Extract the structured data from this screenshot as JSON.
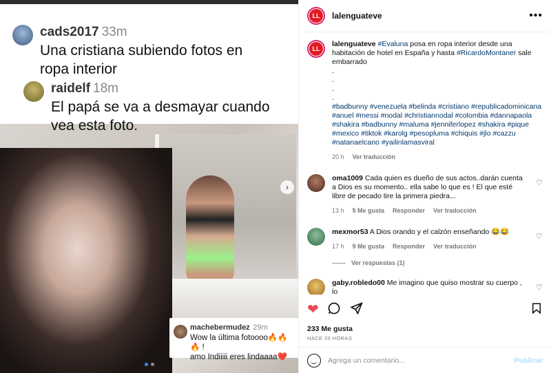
{
  "media": {
    "comment1": {
      "user": "cads2017",
      "time": "33m",
      "text_line1": "Una cristiana subiendo fotos en",
      "text_line2": "ropa interior"
    },
    "comment2": {
      "user": "raidelf",
      "time": "18m",
      "text_line1": "El papá se va a desmayar cuando",
      "text_line2": "vea esta foto."
    },
    "comment3": {
      "user": "machebermudez",
      "time": "29m",
      "text_line1": "Wow la última fotoooo🔥🔥🔥 !",
      "text_line2": "amo Indiiiii eres lindaaaa❤️"
    },
    "next_icon": "chevron-right-icon"
  },
  "header": {
    "username": "lalenguateve",
    "avatar_text": "LL",
    "more_icon": "ellipsis-icon",
    "more_label": "•••"
  },
  "caption": {
    "username": "lalenguateve",
    "mention": "#Evaluna",
    "text_a": " posa en ropa interior desde una habitación de hotel en España y hasta ",
    "mention2": "#RicardoMontaner",
    "text_b": " sale embarrado",
    "dots": ".",
    "hashtags": "#badbunny #venezuela #belinda #cristiano #republicadominicana #anuel #messi #nodal #christiannodal #colombia #dannapaola #shakira #badbunny #maluma #jenniferlopez #shakira #pique #mexico #tiktok #karolg #pesopluma #chiquis #jlo #cazzu #natanaelcano #yailinlamasviral",
    "time": "20 h",
    "translate": "Ver traducción"
  },
  "comments": [
    {
      "user": "oma1009",
      "text": "Cada quien es dueño de sus actos..darán cuenta a Dios es su momento.. ella sabe lo que es ! El que esté libre de pecado tire la primera piedra...",
      "time": "13 h",
      "likes": "5 Me gusta",
      "reply": "Responder",
      "translate": "Ver traducción"
    },
    {
      "user": "mexmor53",
      "text": "A Dios orando y el calzón enseñando 😂😂",
      "time": "17 h",
      "likes": "9 Me gusta",
      "reply": "Responder",
      "translate": "Ver traducción"
    },
    {
      "user": "gaby.robledo00",
      "text": "Me imagino que quiso mostrar su cuerpo , lo"
    }
  ],
  "replies_label": "Ver respuestas (1)",
  "actions": {
    "likes": "233 Me gusta",
    "when": "HACE 20 HORAS"
  },
  "composer": {
    "placeholder": "Agrega un comentario...",
    "publish": "Publicar"
  },
  "colors": {
    "like": "#ed4956",
    "link": "#00376b",
    "publish_disabled": "#b2dffc"
  }
}
